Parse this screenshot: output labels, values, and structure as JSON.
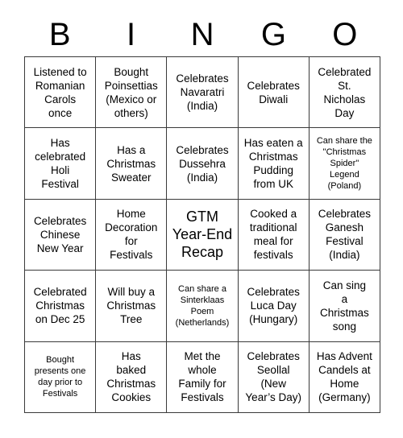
{
  "card": {
    "header_letters": [
      "B",
      "I",
      "N",
      "G",
      "O"
    ],
    "rows": [
      [
        {
          "text": "Listened to\nRomanian\nCarols\nonce",
          "size": "normal"
        },
        {
          "text": "Bought\nPoinsettias\n(Mexico or\nothers)",
          "size": "normal"
        },
        {
          "text": "Celebrates\nNavaratri\n(India)",
          "size": "normal"
        },
        {
          "text": "Celebrates\nDiwali",
          "size": "normal"
        },
        {
          "text": "Celebrated\nSt.\nNicholas\nDay",
          "size": "normal"
        }
      ],
      [
        {
          "text": "Has\ncelebrated\nHoli\nFestival",
          "size": "normal"
        },
        {
          "text": "Has a\nChristmas\nSweater",
          "size": "normal"
        },
        {
          "text": "Celebrates\nDussehra\n(India)",
          "size": "normal"
        },
        {
          "text": "Has eaten a\nChristmas\nPudding\nfrom UK",
          "size": "normal"
        },
        {
          "text": "Can share the\n\"Christmas\nSpider\"\nLegend\n(Poland)",
          "size": "small"
        }
      ],
      [
        {
          "text": "Celebrates\nChinese\nNew Year",
          "size": "normal"
        },
        {
          "text": "Home\nDecoration\nfor\nFestivals",
          "size": "normal"
        },
        {
          "text": "GTM\nYear-End\nRecap",
          "size": "large"
        },
        {
          "text": "Cooked a\ntraditional\nmeal for\nfestivals",
          "size": "normal"
        },
        {
          "text": "Celebrates\nGanesh\nFestival\n(India)",
          "size": "normal"
        }
      ],
      [
        {
          "text": "Celebrated\nChristmas\non Dec 25",
          "size": "normal"
        },
        {
          "text": "Will buy a\nChristmas\nTree",
          "size": "normal"
        },
        {
          "text": "Can share a\nSinterklaas\nPoem\n(Netherlands)",
          "size": "small"
        },
        {
          "text": "Celebrates\nLuca Day\n(Hungary)",
          "size": "normal"
        },
        {
          "text": "Can sing\na\nChristmas\nsong",
          "size": "normal"
        }
      ],
      [
        {
          "text": "Bought\npresents one\nday prior to\nFestivals",
          "size": "small"
        },
        {
          "text": "Has\nbaked\nChristmas\nCookies",
          "size": "normal"
        },
        {
          "text": "Met the\nwhole\nFamily for\nFestivals",
          "size": "normal"
        },
        {
          "text": "Celebrates\nSeollal\n(New\nYear’s Day)",
          "size": "normal"
        },
        {
          "text": "Has Advent\nCandels at\nHome\n(Germany)",
          "size": "normal"
        }
      ]
    ]
  },
  "colors": {
    "border": "#3a3a3a",
    "text": "#000000",
    "background": "#ffffff"
  }
}
